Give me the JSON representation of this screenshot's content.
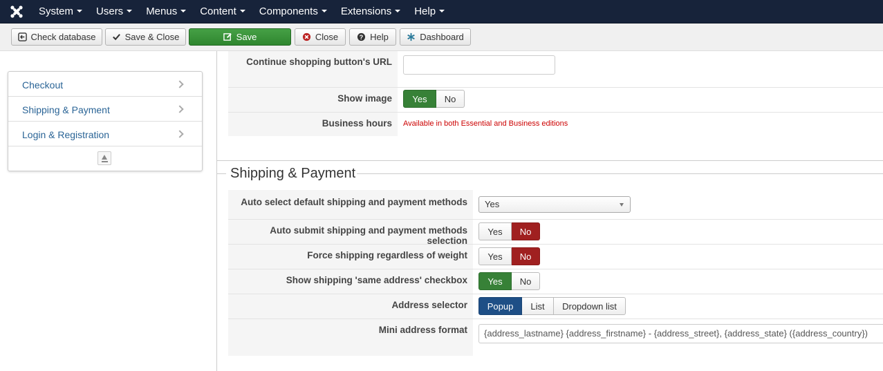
{
  "nav": {
    "logo_icon": "joomla-logo-icon",
    "items": [
      {
        "label": "System"
      },
      {
        "label": "Users"
      },
      {
        "label": "Menus"
      },
      {
        "label": "Content"
      },
      {
        "label": "Components"
      },
      {
        "label": "Extensions"
      },
      {
        "label": "Help"
      }
    ]
  },
  "toolbar": {
    "check_database": "Check database",
    "save_close": "Save & Close",
    "save": "Save",
    "close": "Close",
    "help": "Help",
    "dashboard": "Dashboard"
  },
  "sidebar": {
    "items": [
      {
        "label": "Checkout"
      },
      {
        "label": "Shipping & Payment"
      },
      {
        "label": "Login & Registration"
      }
    ]
  },
  "checkout_section": {
    "continue_url": {
      "label": "Continue shopping button's URL",
      "value": ""
    },
    "show_image": {
      "label": "Show image",
      "yes": "Yes",
      "no": "No",
      "selected": "Yes"
    },
    "business_hours": {
      "label": "Business hours",
      "notice": "Available in both Essential and Business editions"
    }
  },
  "shipping_section": {
    "legend": "Shipping & Payment",
    "auto_select": {
      "label": "Auto select default shipping and payment methods",
      "value": "Yes"
    },
    "auto_submit": {
      "label": "Auto submit shipping and payment methods selection",
      "yes": "Yes",
      "no": "No",
      "selected": "No"
    },
    "force_shipping": {
      "label": "Force shipping regardless of weight",
      "yes": "Yes",
      "no": "No",
      "selected": "No"
    },
    "same_address": {
      "label": "Show shipping 'same address' checkbox",
      "yes": "Yes",
      "no": "No",
      "selected": "Yes"
    },
    "address_selector": {
      "label": "Address selector",
      "options": [
        "Popup",
        "List",
        "Dropdown list"
      ],
      "selected": "Popup"
    },
    "mini_address": {
      "label": "Mini address format",
      "value": "{address_lastname} {address_firstname} - {address_street}, {address_state} ({address_country})"
    }
  },
  "colors": {
    "navbar": "#17233a",
    "active_green": "#378137",
    "active_red": "#a02020",
    "active_blue": "#1e4f86",
    "notice_red": "#cc0000"
  }
}
